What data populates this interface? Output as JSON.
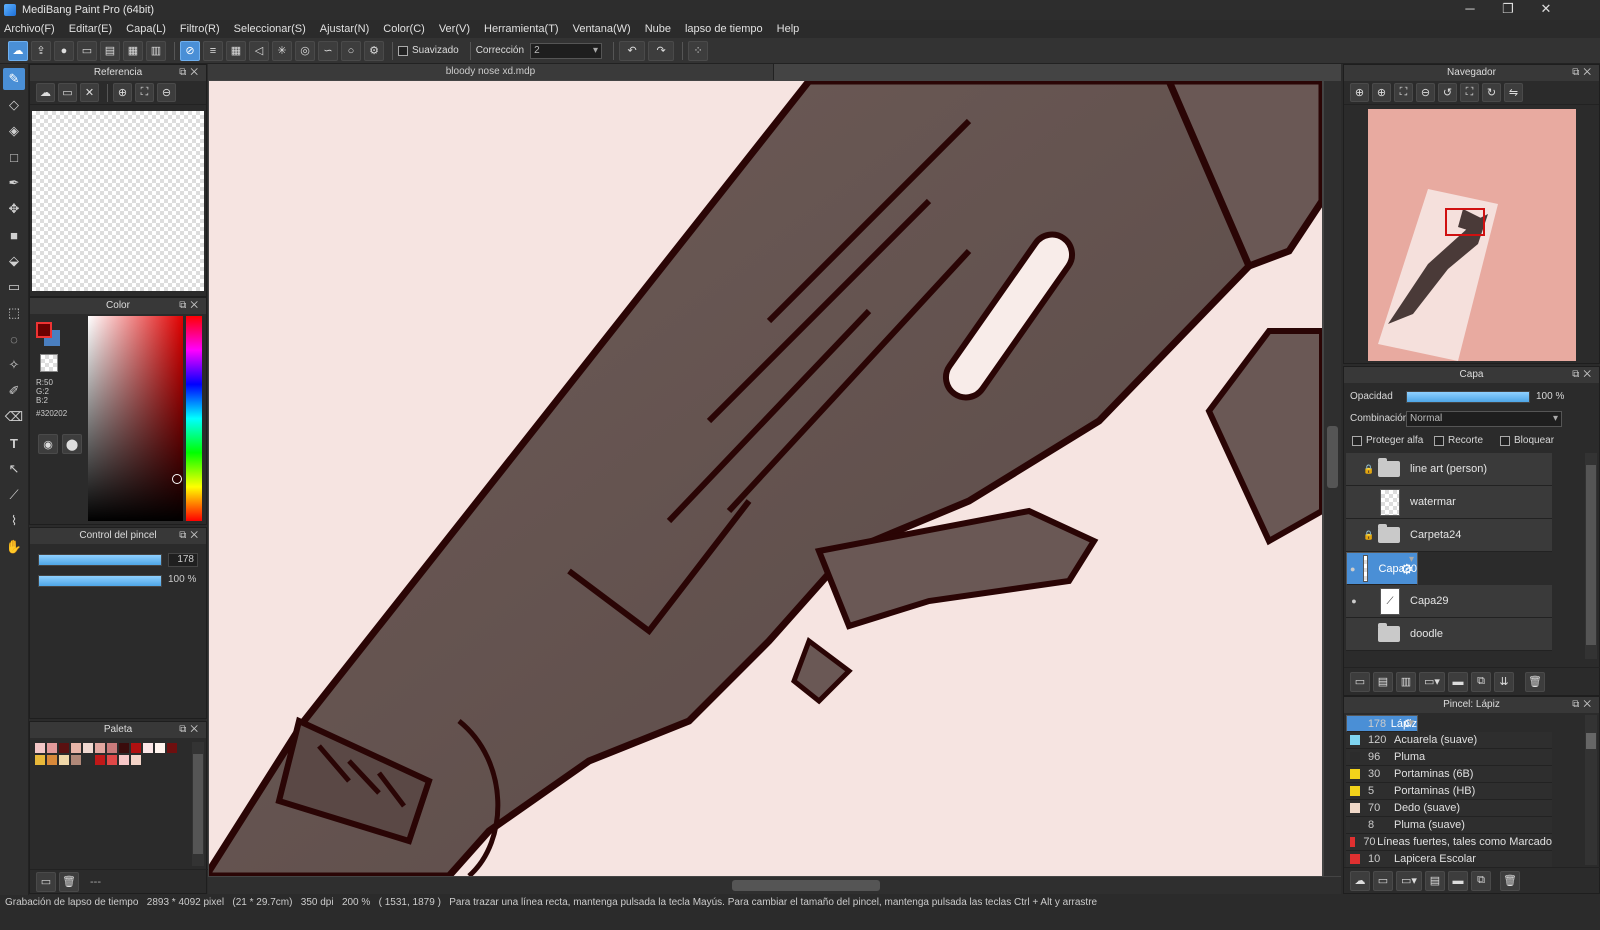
{
  "window": {
    "title": "MediBang Paint Pro (64bit)",
    "min": "─",
    "max": "❐",
    "close": "✕"
  },
  "menu": [
    "Archivo(F)",
    "Editar(E)",
    "Capa(L)",
    "Filtro(R)",
    "Seleccionar(S)",
    "Ajustar(N)",
    "Color(C)",
    "Ver(V)",
    "Herramienta(T)",
    "Ventana(W)",
    "Nube",
    "lapso de tiempo",
    "Help"
  ],
  "toolbar": {
    "smoothing_label": "Suavizado",
    "correction_label": "Corrección",
    "correction_value": "2"
  },
  "document": {
    "tab": "bloody nose xd.mdp"
  },
  "reference": {
    "title": "Referencia"
  },
  "color": {
    "title": "Color",
    "r": "R:50",
    "g": "G:2",
    "b": "B:2",
    "hex": "#320202",
    "primary": "#8b0000",
    "secondary": "#4a7fc0"
  },
  "brush_control": {
    "title": "Control del pincel",
    "size": "178",
    "size_fraction": 1.0,
    "opacity": "100 %",
    "opacity_fraction": 1.0
  },
  "palette": {
    "title": "Paleta",
    "footer": "---",
    "colors": [
      "#f3c7c7",
      "#e39a9a",
      "#5a1010",
      "#e8b5a8",
      "#f0d8d0",
      "#e2a7a0",
      "#c97a7a",
      "#3a0c0c",
      "#b01010",
      "#fbe6e6",
      "#fff4ee",
      "#6e0f0f",
      "#e8b83a",
      "#d8893a",
      "#f0d7a8",
      "#b08878",
      "#2c2c2c",
      "#c01818",
      "#e04848",
      "#f8c8c8",
      "#f4d4c8"
    ]
  },
  "navigator": {
    "title": "Navegador"
  },
  "layers": {
    "title": "Capa",
    "opacity_label": "Opacidad",
    "opacity_value": "100 %",
    "opacity_fraction": 1.0,
    "blend_label": "Combinación",
    "blend_value": "Normal",
    "protect_alpha": "Proteger alfa",
    "clipping": "Recorte",
    "lock": "Bloquear",
    "items": [
      {
        "name": "line art (person)",
        "kind": "folder",
        "locked": true,
        "visible": false
      },
      {
        "name": "watermar",
        "kind": "layer",
        "locked": false,
        "visible": false
      },
      {
        "name": "Carpeta24",
        "kind": "folder",
        "locked": true,
        "visible": false
      },
      {
        "name": "Capa30",
        "kind": "layer",
        "locked": false,
        "visible": true,
        "selected": true
      },
      {
        "name": "Capa29",
        "kind": "layer",
        "locked": false,
        "visible": true
      },
      {
        "name": "doodle",
        "kind": "folder",
        "locked": false,
        "visible": false
      }
    ]
  },
  "brushes": {
    "title": "Pincel: Lápiz",
    "items": [
      {
        "size": "178",
        "name": "Lápiz",
        "color": "#4a8fd6",
        "selected": true
      },
      {
        "size": "120",
        "name": "Acuarela (suave)",
        "color": "#7fd4f0"
      },
      {
        "size": "96",
        "name": "Pluma",
        "color": "#2c2c2c"
      },
      {
        "size": "30",
        "name": "Portaminas (6B)",
        "color": "#f2d21a"
      },
      {
        "size": "5",
        "name": "Portaminas (HB)",
        "color": "#f2d21a"
      },
      {
        "size": "70",
        "name": "Dedo (suave)",
        "color": "#f0d8c8"
      },
      {
        "size": "8",
        "name": "Pluma (suave)",
        "color": "#2c2c2c"
      },
      {
        "size": "70",
        "name": "Líneas fuertes, tales como Marcado",
        "color": "#e03030"
      },
      {
        "size": "10",
        "name": "Lapicera Escolar",
        "color": "#e03030"
      }
    ]
  },
  "status": {
    "rec": "Grabación de lapso de tiempo",
    "size": "2893 * 4092 pixel",
    "cm": "(21 * 29.7cm)",
    "dpi": "350 dpi",
    "zoom": "200 %",
    "coords": "( 1531, 1879 )",
    "hint": "Para trazar una línea recta, mantenga pulsada la tecla Mayús. Para cambiar el tamaño del pincel, mantenga pulsada las teclas Ctrl + Alt y arrastre"
  }
}
